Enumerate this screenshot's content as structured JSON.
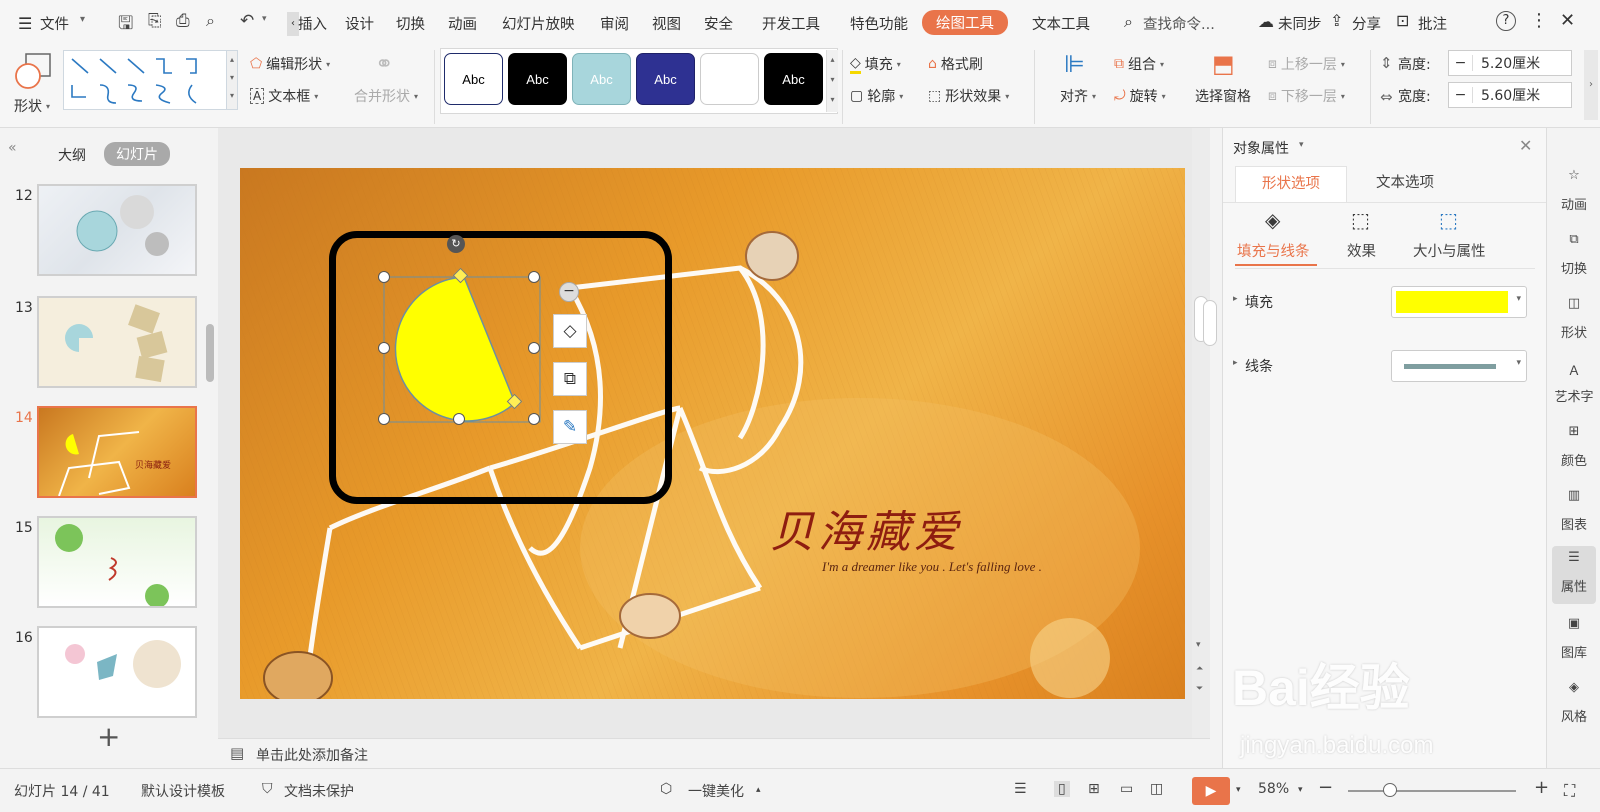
{
  "menubar": {
    "file": "文件",
    "insert": "插入",
    "design": "设计",
    "transition": "切换",
    "animation": "动画",
    "slideshow": "幻灯片放映",
    "review": "审阅",
    "view": "视图",
    "security": "安全",
    "devtools": "开发工具",
    "special": "特色功能",
    "drawing_tools": "绘图工具",
    "text_tools": "文本工具",
    "search": "查找命令...",
    "sync": "未同步",
    "share": "分享",
    "comment": "批注"
  },
  "ribbon": {
    "shape": "形状",
    "edit_shape": "编辑形状",
    "textbox": "文本框",
    "merge_shape": "合并形状",
    "style_sample": "Abc",
    "fill": "填充",
    "format_painter": "格式刷",
    "outline": "轮廓",
    "shape_effect": "形状效果",
    "align": "对齐",
    "group": "组合",
    "rotate": "旋转",
    "selection_pane": "选择窗格",
    "bring_forward": "上移一层",
    "send_backward": "下移一层",
    "height_label": "高度:",
    "height_value": "5.20厘米",
    "width_label": "宽度:",
    "width_value": "5.60厘米",
    "minus": "−"
  },
  "leftpane": {
    "outline_tab": "大纲",
    "slides_tab": "幻灯片",
    "slides": [
      {
        "num": "12"
      },
      {
        "num": "13"
      },
      {
        "num": "14"
      },
      {
        "num": "15"
      },
      {
        "num": "16"
      }
    ],
    "add": "+"
  },
  "slide": {
    "title": "贝海藏爱",
    "subtitle": "I'm a dreamer like you . Let's falling love ."
  },
  "notes": {
    "placeholder": "单击此处添加备注"
  },
  "rpanel": {
    "title": "对象属性",
    "tab_shape": "形状选项",
    "tab_text": "文本选项",
    "sub_fill": "填充与线条",
    "sub_effect": "效果",
    "sub_size": "大小与属性",
    "fill_label": "填充",
    "line_label": "线条",
    "fill_color": "#ffff00",
    "line_color": "#7f9ea0"
  },
  "rside": {
    "items": [
      {
        "label": "动画"
      },
      {
        "label": "切换"
      },
      {
        "label": "形状"
      },
      {
        "label": "艺术字"
      },
      {
        "label": "颜色"
      },
      {
        "label": "图表"
      },
      {
        "label": "属性"
      },
      {
        "label": "图库"
      },
      {
        "label": "风格"
      }
    ]
  },
  "status": {
    "slide_count": "幻灯片 14 / 41",
    "template": "默认设计模板",
    "protect": "文档未保护",
    "beautify": "一键美化",
    "zoom": "58%"
  },
  "watermark": {
    "brand": "Bai经验",
    "url": "jingyan.baidu.com"
  },
  "colors": {
    "accent": "#e9744a",
    "shape_fill": "#ffff00",
    "slide_bg": "#e89a2a"
  }
}
